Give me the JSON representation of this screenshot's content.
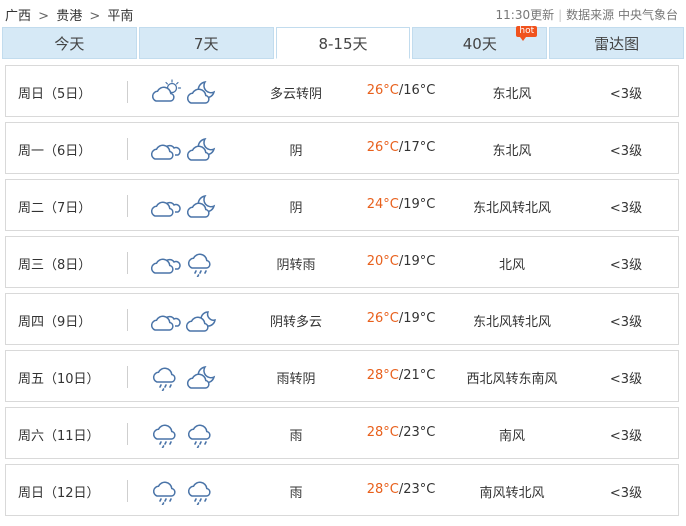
{
  "breadcrumb": {
    "province": "广西",
    "city": "贵港",
    "district": "平南",
    "sep": ">"
  },
  "meta": {
    "updated": "11:30更新",
    "source": "数据来源 中央气象台"
  },
  "tabs": [
    {
      "label": "今天",
      "active": false
    },
    {
      "label": "7天",
      "active": false
    },
    {
      "label": "8-15天",
      "active": true
    },
    {
      "label": "40天",
      "active": false,
      "badge": "hot"
    },
    {
      "label": "雷达图",
      "active": false
    }
  ],
  "forecast": [
    {
      "day": "周日（5日）",
      "icons": [
        "partly-cloudy-day-icon",
        "partly-cloudy-night-icon"
      ],
      "desc": "多云转阴",
      "high": "26°C",
      "low": "/16°C",
      "wind": "东北风",
      "level": "<3级"
    },
    {
      "day": "周一（6日）",
      "icons": [
        "overcast-icon",
        "partly-cloudy-night-icon"
      ],
      "desc": "阴",
      "high": "26°C",
      "low": "/17°C",
      "wind": "东北风",
      "level": "<3级"
    },
    {
      "day": "周二（7日）",
      "icons": [
        "overcast-icon",
        "partly-cloudy-night-icon"
      ],
      "desc": "阴",
      "high": "24°C",
      "low": "/19°C",
      "wind": "东北风转北风",
      "level": "<3级"
    },
    {
      "day": "周三（8日）",
      "icons": [
        "overcast-icon",
        "rain-icon"
      ],
      "desc": "阴转雨",
      "high": "20°C",
      "low": "/19°C",
      "wind": "北风",
      "level": "<3级"
    },
    {
      "day": "周四（9日）",
      "icons": [
        "overcast-icon",
        "cloudy-night-icon"
      ],
      "desc": "阴转多云",
      "high": "26°C",
      "low": "/19°C",
      "wind": "东北风转北风",
      "level": "<3级"
    },
    {
      "day": "周五（10日）",
      "icons": [
        "rain-icon",
        "partly-cloudy-night-icon"
      ],
      "desc": "雨转阴",
      "high": "28°C",
      "low": "/21°C",
      "wind": "西北风转东南风",
      "level": "<3级"
    },
    {
      "day": "周六（11日）",
      "icons": [
        "rain-icon",
        "rain-icon"
      ],
      "desc": "雨",
      "high": "28°C",
      "low": "/23°C",
      "wind": "南风",
      "level": "<3级"
    },
    {
      "day": "周日（12日）",
      "icons": [
        "rain-icon",
        "rain-icon"
      ],
      "desc": "雨",
      "high": "28°C",
      "low": "/23°C",
      "wind": "南风转北风",
      "level": "<3级"
    }
  ]
}
